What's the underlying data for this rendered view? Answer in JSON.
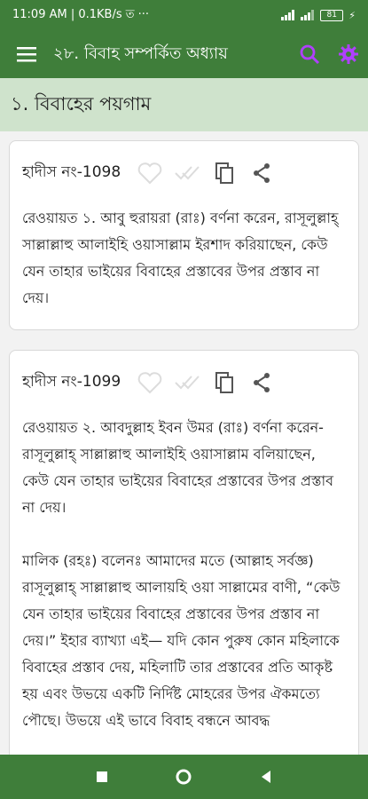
{
  "status_bar": {
    "time_text": "11:09 AM | 0.1KB/s",
    "extra_icons": "ত ···",
    "battery": "81"
  },
  "app_bar": {
    "title": "২৮. বিবাহ সম্পর্কিত অধ্যায়",
    "menu_icon": "hamburger-menu-icon",
    "search_icon": "search-icon",
    "settings_icon": "gear-icon",
    "search_color": "#b040ff",
    "settings_color": "#b040ff"
  },
  "section": {
    "title": "১. বিবাহের পয়গাম"
  },
  "hadiths": [
    {
      "number": "হাদীস নং-1098",
      "text": "রেওয়ায়ত ১. আবু হুরায়রা (রাঃ) বর্ণনা করেন, রাসূলুল্লাহ্ সাল্লাল্লাহু আলাইহি ওয়াসাল্লাম ইরশাদ করিয়াছেন, কেউ যেন তাহার ভাইয়ের বিবাহের প্রস্তাবের উপর প্রস্তাব না দেয়।"
    },
    {
      "number": "হাদীস নং-1099",
      "text": "রেওয়ায়ত ২. আবদুল্লাহ ইবন উমর (রাঃ) বর্ণনা করেন-রাসূলুল্লাহ্ সাল্লাল্লাহু আলাইহি ওয়াসাল্লাম বলিয়াছেন, কেউ যেন তাহার ভাইয়ের বিবাহের প্রস্তাবের উপর প্রস্তাব না দেয়।\n\nমালিক (রহঃ) বলেনঃ আমাদের মতে (আল্লাহ সর্বজ্ঞ) রাসূলুল্লাহ্ সাল্লাল্লাহু আলায়হি ওয়া সাল্লামের বাণী, “কেউ যেন তাহার ভাইয়ের বিবাহের প্রস্তাবের উপর প্রস্তাব না দেয়।” ইহার ব্যাখ্যা এই— যদি কোন পুরুষ কোন মহিলাকে বিবাহের প্রস্তাব দেয়, মহিলাটি তার প্রস্তাবের প্রতি আকৃষ্ট হয় এবং উভয়ে একটি নির্দিষ্ট মোহরের উপর ঐকমত্যে পৌছে। উভয়ে এই ভাবে বিবাহ বন্ধনে আবদ্ধ"
    }
  ],
  "card_icons": [
    "heart-outline-icon",
    "double-check-icon",
    "copy-icon",
    "share-icon"
  ],
  "nav_bar": {
    "icons": [
      "square-recents-icon",
      "circle-home-icon",
      "triangle-back-icon"
    ]
  }
}
